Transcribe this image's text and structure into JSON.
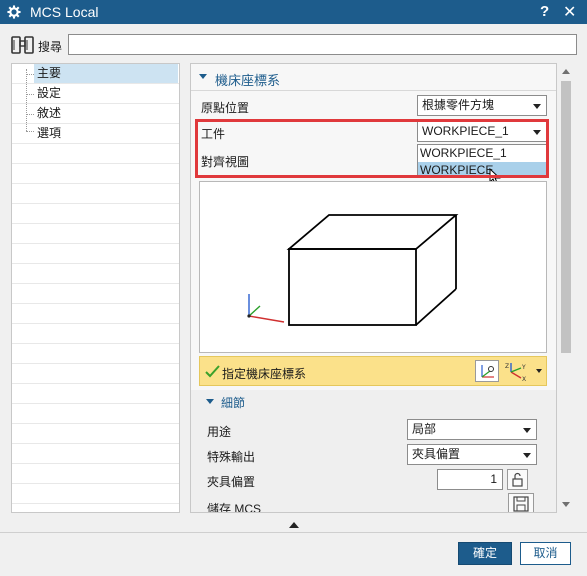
{
  "window": {
    "title": "MCS Local",
    "help": "?",
    "close": "✕"
  },
  "search": {
    "label": "搜尋",
    "value": ""
  },
  "tree": {
    "items": [
      "主要",
      "設定",
      "敘述",
      "選項"
    ],
    "selected": 0
  },
  "section": {
    "title": "機床座標系",
    "fields": {
      "origin_label": "原點位置",
      "origin_value": "根據零件方塊",
      "workpiece_label": "工件",
      "workpiece_value": "WORKPIECE_1",
      "align_view_label": "對齊視圖"
    },
    "workpiece_options": [
      "WORKPIECE_1",
      "WORKPIECE"
    ],
    "workpiece_hover_index": 1
  },
  "specify": {
    "label": "指定機床座標系",
    "check_color": "#3aa12b"
  },
  "details": {
    "title": "細節",
    "purpose_label": "用途",
    "purpose_value": "局部",
    "special_output_label": "特殊輸出",
    "special_output_value": "夾具偏置",
    "fixture_offset_label": "夾具偏置",
    "fixture_offset_value": "1",
    "save_mcs_label": "儲存 MCS"
  },
  "buttons": {
    "ok": "確定",
    "cancel": "取消"
  },
  "colors": {
    "titlebar": "#1d5c8c",
    "highlight": "#e0393c",
    "specify_bg": "#fbe18a",
    "selection": "#cde3f2"
  }
}
